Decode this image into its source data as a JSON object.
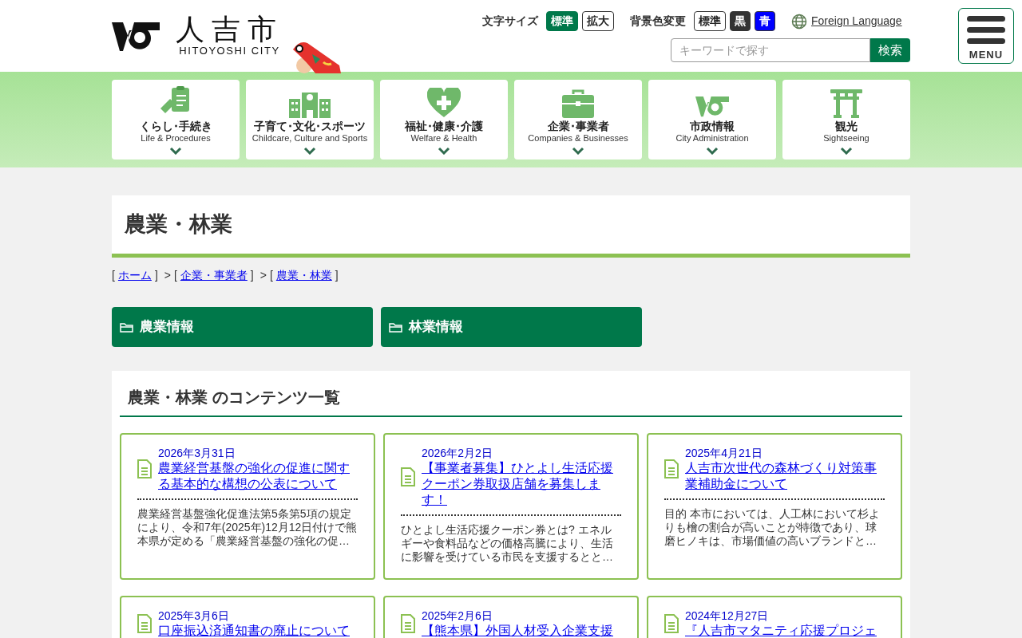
{
  "header": {
    "logo_title": "人吉市",
    "logo_subtitle": "HITOYOSHI CITY",
    "font_size": {
      "label": "文字サイズ",
      "options": [
        {
          "label": "標準",
          "selected": true
        },
        {
          "label": "拡大",
          "selected": false
        }
      ]
    },
    "background": {
      "label": "背景色変更",
      "options": [
        {
          "label": "標準",
          "color": "#ffffff"
        },
        {
          "label": "黒",
          "color": "#333333"
        },
        {
          "label": "青",
          "color": "#0000ff"
        }
      ]
    },
    "language_link": "Foreign Language",
    "search": {
      "placeholder": "キーワードで探す",
      "button": "検索"
    },
    "menu_button": "MENU"
  },
  "nav": [
    {
      "kind": "clipboard",
      "label": "くらし･手続き",
      "sublabel": "Life & Procedures"
    },
    {
      "kind": "school",
      "label": "子育て･文化･スポーツ",
      "sublabel": "Childcare, Culture and Sports"
    },
    {
      "kind": "heart",
      "label": "福祉･健康･介護",
      "sublabel": "Welfare & Health"
    },
    {
      "kind": "briefcase",
      "label": "企業･事業者",
      "sublabel": "Companies & Businesses"
    },
    {
      "kind": "emblem",
      "label": "市政情報",
      "sublabel": "City Administration"
    },
    {
      "kind": "gate",
      "label": "観光",
      "sublabel": "Sightseeing"
    }
  ],
  "page_title": "農業・林業",
  "breadcrumb": [
    {
      "open": "[",
      "label": "ホーム",
      "close": "]"
    },
    {
      "lead": ">",
      "open": "[",
      "label": "企業・事業者",
      "close": "]"
    },
    {
      "lead": ">",
      "open": "[",
      "label": "農業・林業",
      "close": "]"
    }
  ],
  "categories": [
    "農業情報",
    "林業情報"
  ],
  "contents": {
    "title": "農業・林業 のコンテンツ一覧",
    "items": [
      {
        "date": "2026年3月31日",
        "title": "農業経営基盤の強化の促進に関する基本的な構想の公表について",
        "summary": "農業経営基盤強化促進法第5条第5項の規定により、令和7年(2025年)12月12日付けで熊本県が定める「農業経営基盤の強化の促…"
      },
      {
        "date": "2026年2月2日",
        "title": "【事業者募集】ひとよし生活応援クーポン券取扱店舗を募集します！",
        "summary": "ひとよし生活応援クーポン券とは? エネルギーや食料品などの価格高騰により、生活に影響を受けている市民を支援するとと…"
      },
      {
        "date": "2025年4月21日",
        "title": "人吉市次世代の森林づくり対策事業補助金について",
        "summary": "目的 本市においては、人工林において杉よりも檜の割合が高いことが特徴であり、球磨ヒノキは、市場価値の高いブランドと…"
      },
      {
        "date": "2025年3月6日",
        "title": "口座振込済通知書の廃止について"
      },
      {
        "date": "2025年2月6日",
        "title": "【熊本県】外国人材受入企業支援"
      },
      {
        "date": "2024年12月27日",
        "title": "『人吉市マタニティ応援プロジェ"
      }
    ]
  }
}
